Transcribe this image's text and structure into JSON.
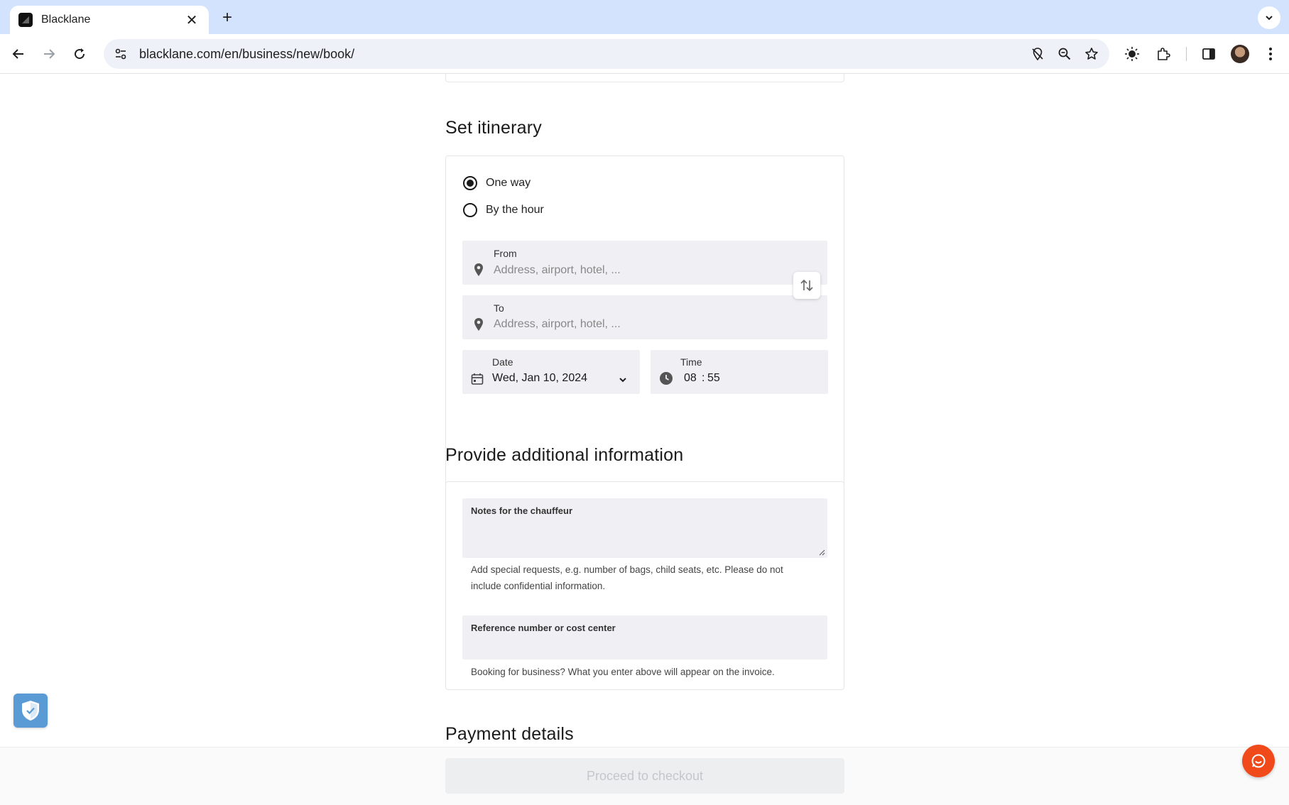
{
  "browser": {
    "tab_title": "Blacklane",
    "url": "blacklane.com/en/business/new/book/"
  },
  "itinerary": {
    "heading": "Set itinerary",
    "trip_types": [
      {
        "label": "One way",
        "selected": true
      },
      {
        "label": "By the hour",
        "selected": false
      }
    ],
    "from": {
      "label": "From",
      "placeholder": "Address, airport, hotel, ..."
    },
    "to": {
      "label": "To",
      "placeholder": "Address, airport, hotel, ..."
    },
    "date": {
      "label": "Date",
      "value": "Wed, Jan 10, 2024"
    },
    "time": {
      "label": "Time",
      "hours": "08",
      "separator": ":",
      "minutes": "55"
    }
  },
  "additional": {
    "heading": "Provide additional information",
    "notes_label": "Notes for the chauffeur",
    "notes_helper": "Add special requests, e.g. number of bags, child seats, etc. Please do not include confidential information.",
    "reference_label": "Reference number or cost center",
    "reference_helper": "Booking for business? What you enter above will appear on the invoice."
  },
  "payment": {
    "heading": "Payment details"
  },
  "footer": {
    "checkout_label": "Proceed to checkout"
  },
  "colors": {
    "tabbar": "#d3e3fd",
    "field_bg": "#f0f0f4",
    "chat_accent": "#f04a1a",
    "shield_accent": "#5b9bd5",
    "checkout_disabled": "#eceef0"
  }
}
